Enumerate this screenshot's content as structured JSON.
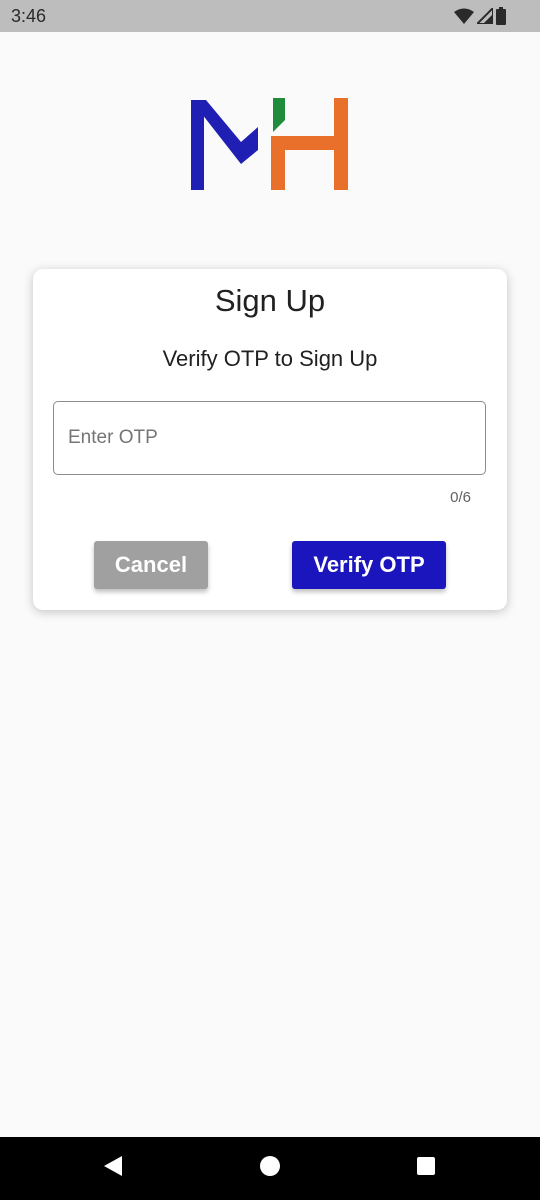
{
  "status_bar": {
    "time": "3:46",
    "icons": [
      "wifi-icon",
      "cellular-signal-icon",
      "battery-icon"
    ]
  },
  "logo": {
    "text": "MH",
    "colors": {
      "m": "#1f1fb3",
      "accent": "#1e8c3a",
      "h": "#e8702a"
    }
  },
  "dialog": {
    "title": "Sign Up",
    "subtitle": "Verify OTP to Sign Up",
    "otp_input": {
      "value": "",
      "placeholder": "Enter OTP"
    },
    "counter": "0/6",
    "cancel_label": "Cancel",
    "verify_label": "Verify OTP"
  },
  "colors": {
    "background": "#fafafa",
    "primary_button": "#1a15bd",
    "cancel_button": "#a0a0a0",
    "status_bar": "#bdbdbd",
    "nav_bar": "#000000"
  },
  "nav_bar": {
    "buttons": [
      "back-icon",
      "home-icon",
      "recents-icon"
    ]
  }
}
